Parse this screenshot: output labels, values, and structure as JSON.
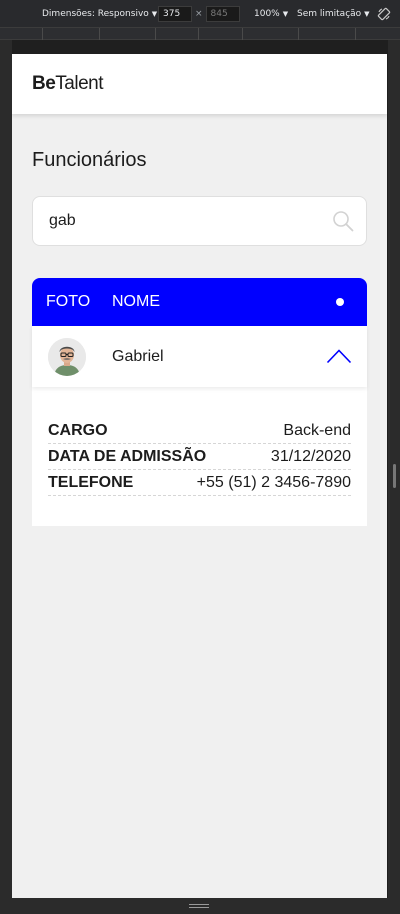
{
  "devtools": {
    "dimensions_label": "Dimensões: Responsivo",
    "width_value": "375",
    "height_value": "845",
    "times_sign": "×",
    "zoom": "100%",
    "throttle": "Sem limitação"
  },
  "header": {
    "logo_bold": "Be",
    "logo_light": "Talent"
  },
  "page": {
    "title": "Funcionários"
  },
  "search": {
    "value": "gab"
  },
  "table": {
    "col_photo": "FOTO",
    "col_name": "NOME",
    "rows": [
      {
        "name": "Gabriel",
        "details": [
          {
            "label": "CARGO",
            "value": "Back-end"
          },
          {
            "label": "DATA DE ADMISSÃO",
            "value": "31/12/2020"
          },
          {
            "label": "TELEFONE",
            "value": "+55 (51) 2 3456-7890"
          }
        ]
      }
    ]
  },
  "colors": {
    "accent": "#0000ff",
    "background": "#f0f0f0",
    "text": "#1c1c1c"
  },
  "icons": {
    "search": "search-icon",
    "expand": "chevron-up-icon",
    "rotate": "rotate-device-icon"
  }
}
